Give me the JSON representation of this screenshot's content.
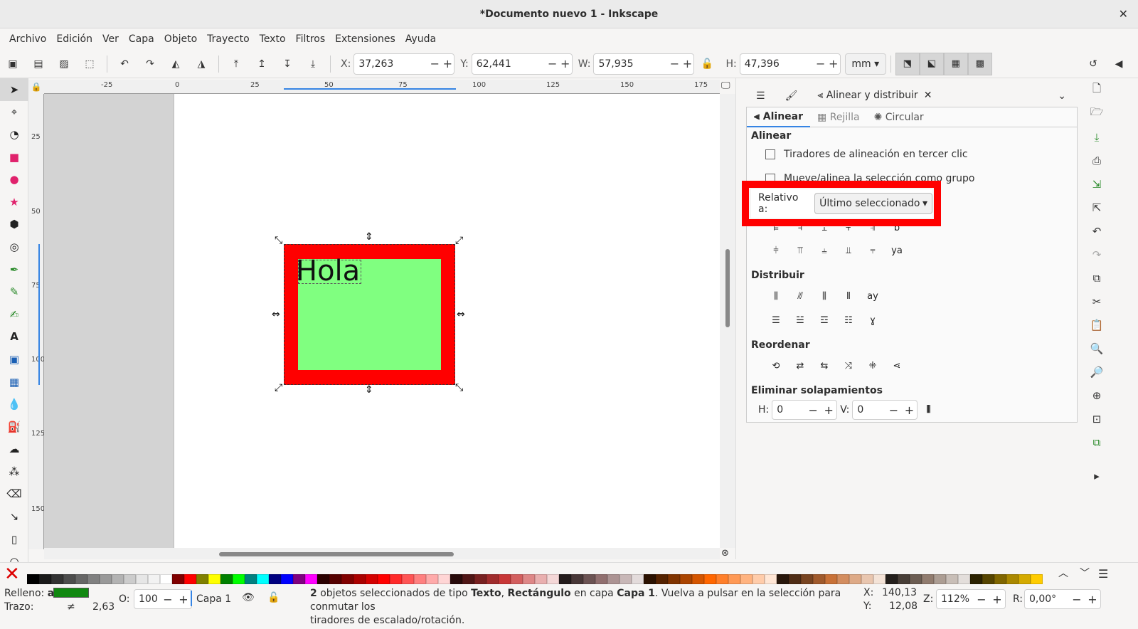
{
  "window": {
    "title": "*Documento nuevo 1 - Inkscape",
    "close": "✕"
  },
  "menu": [
    "Archivo",
    "Edición",
    "Ver",
    "Capa",
    "Objeto",
    "Trayecto",
    "Texto",
    "Filtros",
    "Extensiones",
    "Ayuda"
  ],
  "controls": {
    "x_label": "X:",
    "x_value": "37,263",
    "y_label": "Y:",
    "y_value": "62,441",
    "w_label": "W:",
    "w_value": "57,935",
    "h_label": "H:",
    "h_value": "47,396",
    "unit": "mm"
  },
  "rulers": {
    "h_ticks": [
      "-25",
      "0",
      "25",
      "50",
      "75",
      "100",
      "125",
      "150",
      "175"
    ],
    "v_ticks": [
      "25",
      "50",
      "75",
      "100",
      "125",
      "150"
    ]
  },
  "canvas": {
    "text": "Hola"
  },
  "dock": {
    "tab_active": "Alinear y distribuir",
    "subtabs": [
      "Alinear",
      "Rejilla",
      "Circular"
    ],
    "align_title": "Alinear",
    "checkbox1": "Tiradores de alineación en tercer clic",
    "checkbox2": "Mueve/alinea la selección como grupo",
    "relative_label": "Relativo a:",
    "relative_value": "Último seleccionado",
    "distribute_title": "Distribuir",
    "reorder_title": "Reordenar",
    "overlap_title": "Eliminar solapamientos",
    "overlap_h_label": "H:",
    "overlap_h_value": "0",
    "overlap_v_label": "V:",
    "overlap_v_value": "0"
  },
  "status": {
    "fill_label": "Relleno:",
    "fill_value": "a",
    "stroke_label": "Trazo:",
    "stroke_value": "≠",
    "stroke_width": "2,63",
    "opacity_label": "O:",
    "opacity_value": "100",
    "layer": "Capa 1",
    "message_bold1": "2",
    "message_part1": " objetos seleccionados de tipo ",
    "message_bold2": "Texto",
    "message_part2": ", ",
    "message_bold3": "Rectángulo",
    "message_part3": " en capa ",
    "message_bold4": "Capa 1",
    "message_part4": ". Vuelva a pulsar en la selección para conmutar los",
    "message_line2": "tiradores de escalado/rotación.",
    "cursor_x_label": "X:",
    "cursor_x": "140,13",
    "cursor_y_label": "Y:",
    "cursor_y": "12,08",
    "zoom_label": "Z:",
    "zoom": "112%",
    "rotation_label": "R:",
    "rotation": "0,00°"
  },
  "palette_colors": [
    "#000000",
    "#1a1a1a",
    "#333333",
    "#4d4d4d",
    "#666666",
    "#808080",
    "#999999",
    "#b3b3b3",
    "#cccccc",
    "#e6e6e6",
    "#f2f2f2",
    "#ffffff",
    "#800000",
    "#ff0000",
    "#808000",
    "#ffff00",
    "#008000",
    "#00ff00",
    "#008080",
    "#00ffff",
    "#000080",
    "#0000ff",
    "#800080",
    "#ff00ff",
    "#2b0000",
    "#550000",
    "#800000",
    "#aa0000",
    "#d40000",
    "#ff0000",
    "#ff2a2a",
    "#ff5555",
    "#ff8080",
    "#ffaaaa",
    "#ffd5d5",
    "#280b0b",
    "#501616",
    "#782121",
    "#a02c2c",
    "#c83737",
    "#d35f5f",
    "#de8787",
    "#e9afaf",
    "#f4d7d7",
    "#241c1c",
    "#483737",
    "#6c5353",
    "#916f6f",
    "#ac9393",
    "#c8b7b7",
    "#e3dbdb",
    "#2b1100",
    "#552200",
    "#803300",
    "#aa4400",
    "#d45500",
    "#ff6600",
    "#ff7f2a",
    "#ff9955",
    "#ffb380",
    "#ffccaa",
    "#ffe6d5",
    "#28170b",
    "#502d16",
    "#784421",
    "#a05a2c",
    "#c87137",
    "#d38d5f",
    "#deaa87",
    "#e9c6af",
    "#f4e3d7",
    "#241f1c",
    "#483e37",
    "#6c5d53",
    "#917c6f",
    "#ac9d93",
    "#c8beb7",
    "#e3dedb",
    "#2b2200",
    "#554400",
    "#806600",
    "#aa8800",
    "#d4aa00",
    "#ffcc00"
  ]
}
